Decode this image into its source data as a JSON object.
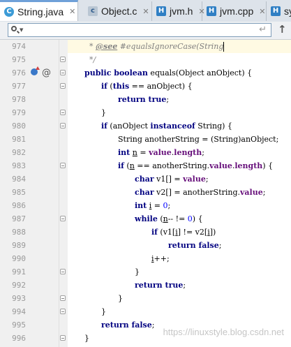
{
  "tabs": [
    {
      "label": "String.java",
      "icon": "class-icon",
      "active": true
    },
    {
      "label": "Object.c",
      "icon": "c-file-icon"
    },
    {
      "label": "jvm.h",
      "icon": "h-file-icon"
    },
    {
      "label": "jvm.cpp",
      "icon": "h-file-icon"
    },
    {
      "label": "sy",
      "icon": "h-file-icon"
    }
  ],
  "search": {
    "value": "",
    "placeholder": ""
  },
  "lines": [
    {
      "n": "974",
      "doc": "* ",
      "tag": "@see",
      "text": " #equalsIgnoreCase(String"
    },
    {
      "n": "975",
      "doc": "*/"
    },
    {
      "n": "976",
      "kw1": "public boolean",
      "t1": " equals(Object anObject) {"
    },
    {
      "n": "977",
      "kw1": "if",
      "t1": " (",
      "kw2": "this",
      "t2": " == anObject) {"
    },
    {
      "n": "978",
      "kw1": "return true",
      "t1": ";"
    },
    {
      "n": "979",
      "t1": "}"
    },
    {
      "n": "980",
      "kw1": "if",
      "t1": " (anObject ",
      "kw2": "instanceof",
      "t2": " String) {"
    },
    {
      "n": "981",
      "t1": "String anotherString = (String)anObject;"
    },
    {
      "n": "982",
      "kw1": "int",
      "u": "n",
      "t1": " = ",
      "f1": "value",
      "t2": ".",
      "f2": "length",
      "t3": ";"
    },
    {
      "n": "983",
      "kw1": "if",
      "t1": " (",
      "u": "n",
      "t2": " == anotherString.",
      "f1": "value",
      "t3": ".",
      "f2": "length",
      "t4": ") {"
    },
    {
      "n": "984",
      "kw1": "char",
      "t1": " v1[] = ",
      "f1": "value",
      "t2": ";"
    },
    {
      "n": "985",
      "kw1": "char",
      "t1": " v2[] = anotherString.",
      "f1": "value",
      "t2": ";"
    },
    {
      "n": "986",
      "kw1": "int",
      "u": "i",
      "t1": " = ",
      "num": "0",
      "t2": ";"
    },
    {
      "n": "987",
      "kw1": "while",
      "t1": " (",
      "u": "n",
      "t2": "-- != ",
      "num": "0",
      "t3": ") {"
    },
    {
      "n": "988",
      "kw1": "if",
      "t1": " (v1[",
      "u": "i",
      "t2": "] != v2[",
      "u2": "i",
      "t3": "])"
    },
    {
      "n": "989",
      "kw1": "return false",
      "t1": ";"
    },
    {
      "n": "990",
      "u": "i",
      "t1": "++;"
    },
    {
      "n": "991",
      "t1": "}"
    },
    {
      "n": "992",
      "kw1": "return true",
      "t1": ";"
    },
    {
      "n": "993",
      "t1": "}"
    },
    {
      "n": "994",
      "t1": "}"
    },
    {
      "n": "995",
      "kw1": "return false",
      "t1": ";"
    },
    {
      "n": "996",
      "t1": "}"
    }
  ],
  "watermark": "https://linuxstyle.blog.csdn.net",
  "colors": {
    "keyword": "#000080",
    "field": "#660e7a",
    "comment": "#808080",
    "number": "#0000ff"
  }
}
